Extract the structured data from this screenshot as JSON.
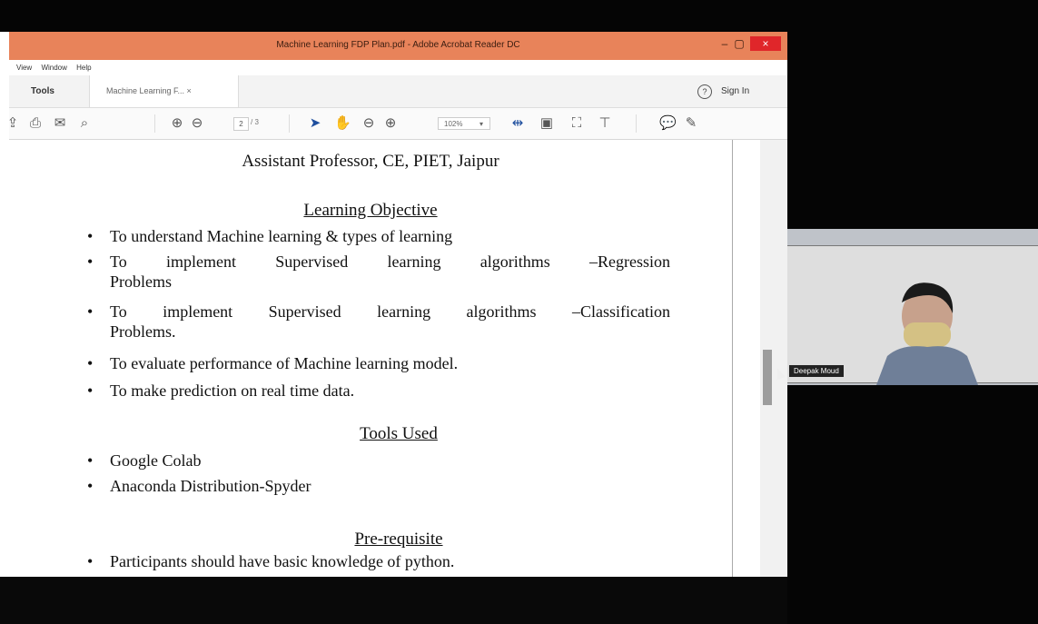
{
  "window": {
    "title": "Machine Learning FDP Plan.pdf - Adobe Acrobat Reader DC",
    "minimize": "–",
    "maximize": "▢",
    "close": "×"
  },
  "menu": [
    "View",
    "Window",
    "Help"
  ],
  "tabs": {
    "tools": "Tools",
    "document": "Machine Learning F...  ×"
  },
  "header": {
    "help": "?",
    "sign_in": "Sign In"
  },
  "toolbar": {
    "current_page": "2",
    "page_total": "/ 3",
    "zoom": "102%"
  },
  "document": {
    "subtitle": "Assistant Professor, CE, PIET, Jaipur",
    "objective_heading": "Learning Objective",
    "objectives": [
      "To understand Machine learning & types of learning",
      "To implement Supervised learning algorithms –Regression",
      "Problems",
      "To implement Supervised learning algorithms –Classification",
      "Problems.",
      "To evaluate performance of Machine learning model.",
      "To make prediction on real time data."
    ],
    "tools_heading": "Tools Used",
    "tools": [
      "Google Colab",
      "Anaconda Distribution-Spyder"
    ],
    "prereq_heading": "Pre-requisite",
    "prereqs": [
      "Participants should have basic knowledge of python."
    ]
  },
  "video": {
    "participant_name": "Deepak Moud"
  },
  "colors": {
    "titlebar": "#e8835a",
    "background": "#050505",
    "accent": "#1f4f9e"
  },
  "icons": [
    "upload-icon",
    "print-icon",
    "mail-icon",
    "search-icon",
    "page-up-icon",
    "page-down-icon",
    "select-icon",
    "hand-icon",
    "zoom-out-icon",
    "zoom-in-icon",
    "fit-width-icon",
    "scroll-mode-icon",
    "fullscreen-icon",
    "stamp-icon",
    "comment-icon",
    "pen-icon"
  ]
}
